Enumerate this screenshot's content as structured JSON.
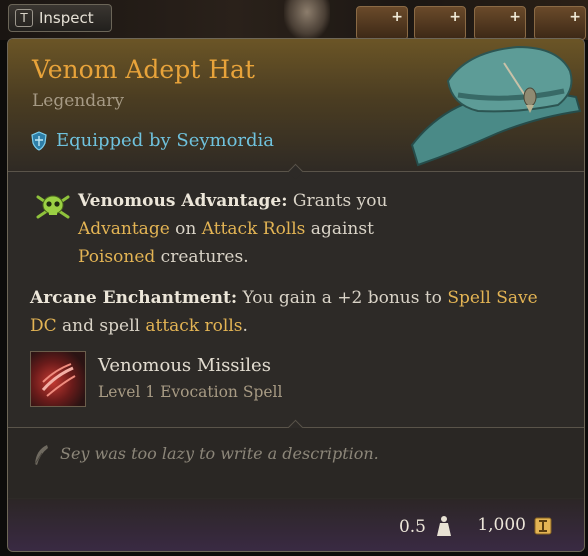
{
  "toolbar": {
    "inspect_key": "T",
    "inspect_label": "Inspect"
  },
  "item": {
    "name": "Venom Adept Hat",
    "rarity": "Legendary",
    "equipped_by": "Equipped by Seymordia",
    "equipped_icon": "shield-icon",
    "image_icon": "hat-icon"
  },
  "effects": {
    "venomous": {
      "icon": "skull-crossbones-icon",
      "title": "Venomous Advantage:",
      "t1": " Grants you",
      "h1": "Advantage",
      "t2": " on ",
      "h2": "Attack Rolls",
      "t3": " against",
      "h3": "Poisoned",
      "t4": " creatures."
    },
    "arcane": {
      "title": "Arcane Enchantment:",
      "t1": " You gain a +2 bonus to ",
      "h1": "Spell Save",
      "h1b": "DC",
      "t2": " and spell ",
      "h2": "attack rolls",
      "t3": "."
    }
  },
  "spell": {
    "name": "Venomous Missiles",
    "subtitle": "Level 1 Evocation Spell",
    "icon": "magic-missile-icon"
  },
  "description": {
    "icon": "quill-icon",
    "text": "Sey was too lazy to write a description."
  },
  "footer": {
    "weight": "0.5",
    "weight_icon": "weight-icon",
    "value": "1,000",
    "value_icon": "gold-coin-icon"
  },
  "colors": {
    "title": "#e8a33a",
    "highlight": "#e3b454",
    "equipped": "#6fc2dd"
  }
}
